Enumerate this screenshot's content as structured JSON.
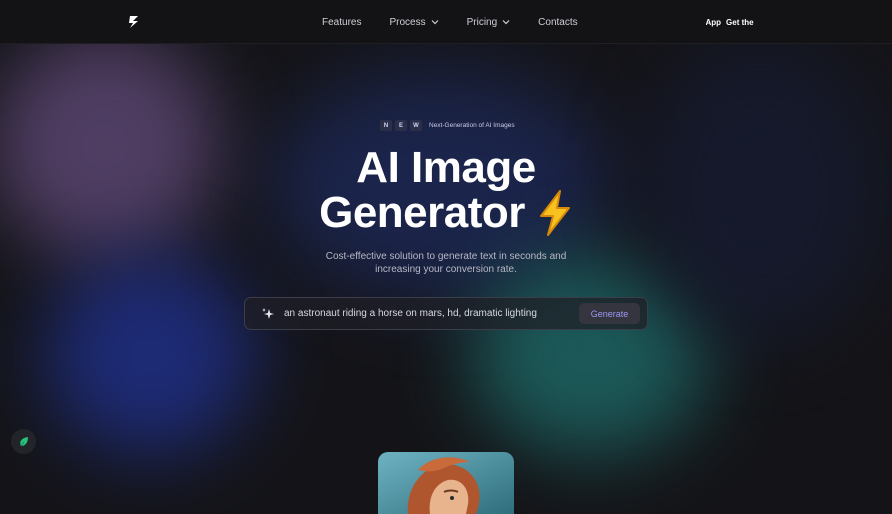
{
  "nav": {
    "logo": "lightning-logo-icon",
    "links": [
      {
        "label": "Features",
        "dropdown": false
      },
      {
        "label": "Process",
        "dropdown": true
      },
      {
        "label": "Pricing",
        "dropdown": true
      },
      {
        "label": "Contacts",
        "dropdown": false
      }
    ],
    "right": {
      "app_label": "Get the App",
      "cta_label": "Get the"
    }
  },
  "hero": {
    "badge": {
      "letters": [
        "N",
        "E",
        "W"
      ],
      "text": "Next-Generation of AI Images"
    },
    "title_line1": "AI Image",
    "title_line2": "Generator",
    "title_icon": "lightning-bolt-icon",
    "subtitle_line1": "Cost-effective solution to generate text in seconds and",
    "subtitle_line2": "increasing your conversion rate.",
    "prompt": {
      "icon": "sparkle-icon",
      "value": "an astronaut riding a horse on mars, hd, dramatic lighting",
      "button_label": "Generate"
    }
  },
  "widgets": {
    "chat_icon": "leaf-chat-icon",
    "preview": "portrait-preview-image"
  },
  "colors": {
    "background": "#141418",
    "accent_text": "#9d97f0",
    "blob_purple": "#5a4570",
    "blob_blue": "#1f2f86",
    "blob_teal": "#1e6a68"
  }
}
